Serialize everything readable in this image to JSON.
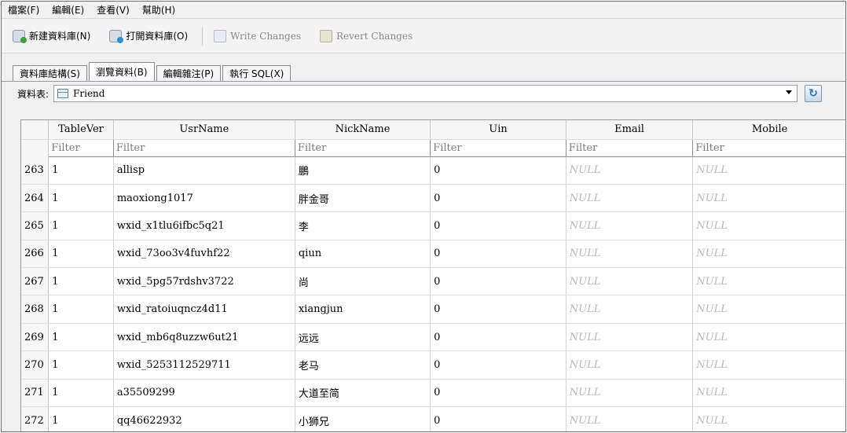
{
  "menu": [
    "檔案(F)",
    "編輯(E)",
    "查看(V)",
    "幫助(H)"
  ],
  "toolbar": {
    "new_db": "新建資料庫(N)",
    "open_db": "打開資料庫(O)",
    "write_changes": "Write Changes",
    "revert_changes": "Revert Changes"
  },
  "tabs": [
    "資料庫結構(S)",
    "瀏覽資料(B)",
    "編輯雜注(P)",
    "執行 SQL(X)"
  ],
  "table_selector": {
    "label": "資料表:",
    "value": "Friend"
  },
  "grid": {
    "columns": [
      "TableVer",
      "UsrName",
      "NickName",
      "Uin",
      "Email",
      "Mobile"
    ],
    "filter_placeholder": "Filter",
    "rows": [
      {
        "num": "263",
        "tablever": "1",
        "usrname": "allisp",
        "nickname": "鵬",
        "uin": "0",
        "email": "NULL",
        "mobile": "NULL"
      },
      {
        "num": "264",
        "tablever": "1",
        "usrname": "maoxiong1017",
        "nickname": "胖金哥",
        "uin": "0",
        "email": "NULL",
        "mobile": "NULL"
      },
      {
        "num": "265",
        "tablever": "1",
        "usrname": "wxid_x1tlu6ifbc5q21",
        "nickname": "李",
        "uin": "0",
        "email": "NULL",
        "mobile": "NULL"
      },
      {
        "num": "266",
        "tablever": "1",
        "usrname": "wxid_73oo3v4fuvhf22",
        "nickname": "qiun",
        "uin": "0",
        "email": "NULL",
        "mobile": "NULL"
      },
      {
        "num": "267",
        "tablever": "1",
        "usrname": "wxid_5pg57rdshv3722",
        "nickname": "尚",
        "uin": "0",
        "email": "NULL",
        "mobile": "NULL"
      },
      {
        "num": "268",
        "tablever": "1",
        "usrname": "wxid_ratoiuqncz4d11",
        "nickname": "xiangjun",
        "uin": "0",
        "email": "NULL",
        "mobile": "NULL"
      },
      {
        "num": "269",
        "tablever": "1",
        "usrname": "wxid_mb6q8uzzw6ut21",
        "nickname": "远远",
        "uin": "0",
        "email": "NULL",
        "mobile": "NULL"
      },
      {
        "num": "270",
        "tablever": "1",
        "usrname": "wxid_5253112529711",
        "nickname": "老马",
        "uin": "0",
        "email": "NULL",
        "mobile": "NULL"
      },
      {
        "num": "271",
        "tablever": "1",
        "usrname": "a35509299",
        "nickname": "大道至简",
        "uin": "0",
        "email": "NULL",
        "mobile": "NULL"
      },
      {
        "num": "272",
        "tablever": "1",
        "usrname": "qq46622932",
        "nickname": "小狮兄",
        "uin": "0",
        "email": "NULL",
        "mobile": "NULL"
      }
    ]
  }
}
